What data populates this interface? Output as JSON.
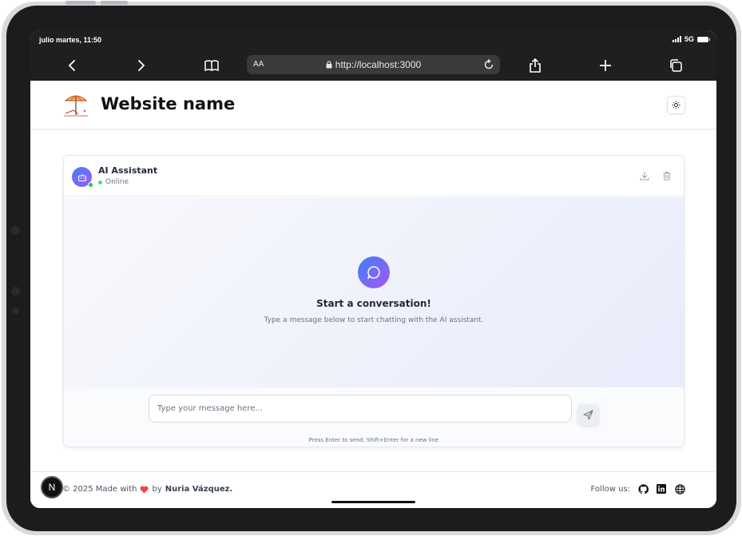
{
  "status_bar": {
    "time": "julio martes, 11:50",
    "network": "5G"
  },
  "browser": {
    "text_size_label": "AA",
    "url": "http://localhost:3000",
    "icons": {
      "back": "chevron-left-icon",
      "forward": "chevron-right-icon",
      "bookmarks": "book-icon",
      "reload": "reload-icon",
      "share": "share-icon",
      "new_tab": "plus-icon",
      "tabs": "tabs-icon"
    }
  },
  "header": {
    "site_title": "Website name",
    "logo": "beach-umbrella-logo",
    "theme_toggle_icon": "sun-icon"
  },
  "chat": {
    "assistant_name": "AI Assistant",
    "status": "Online",
    "actions": [
      "download-icon",
      "trash-icon"
    ],
    "empty_state": {
      "title": "Start a conversation!",
      "subtitle": "Type a message below to start chatting with the AI assistant."
    },
    "input": {
      "placeholder": "Type your message here...",
      "value": ""
    },
    "hint": "Press Enter to send, Shift+Enter for a new line"
  },
  "footer": {
    "badge": "N",
    "copyright_prefix": "© 2025 Made with",
    "by": "by",
    "author": "Nuria Vázquez.",
    "follow_label": "Follow us:",
    "social": [
      "github-icon",
      "linkedin-icon",
      "globe-icon"
    ]
  },
  "colors": {
    "accent_gradient_start": "#3b82f6",
    "accent_gradient_end": "#a855f7",
    "online": "#22c55e",
    "heart": "#ef4444"
  }
}
